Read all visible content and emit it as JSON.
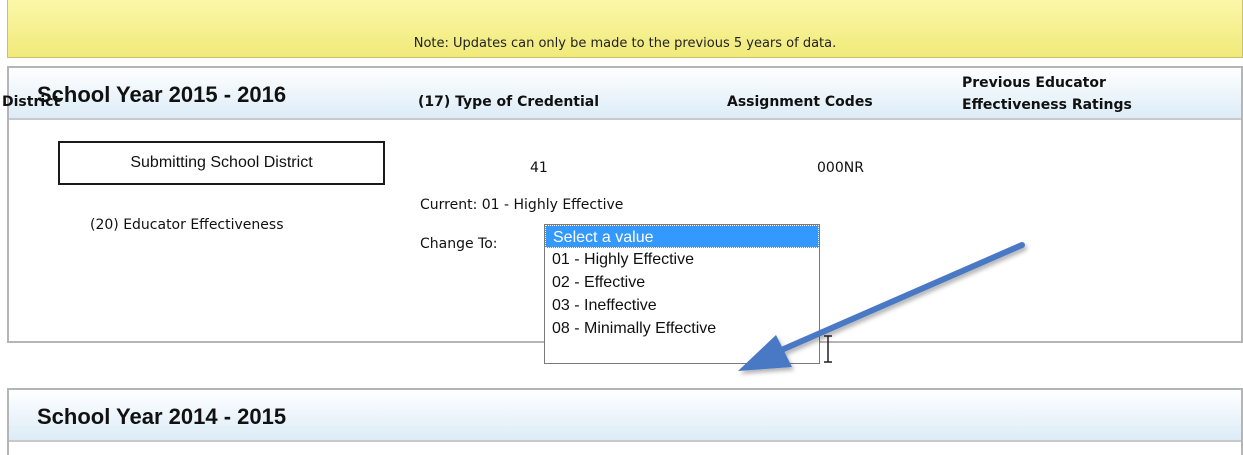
{
  "note": {
    "text": "Note: Updates can only be made to the previous 5 years of data."
  },
  "sections": [
    {
      "title": "School Year 2015 - 2016",
      "columns": {
        "district": "District",
        "credential": "(17) Type of Credential",
        "assignment": "Assignment Codes",
        "previous": "Previous Educator Effectiveness Ratings"
      },
      "district_value": "Submitting School District",
      "credential_value": "41",
      "assignment_value": "000NR",
      "effectiveness_label": "(20) Educator Effectiveness",
      "current_text": "Current: 01 - Highly Effective",
      "change_label": "Change To:",
      "dropdown": {
        "selected": "Select a value",
        "options": [
          "Select a value",
          "01 - Highly Effective",
          "02 - Effective",
          "03 - Ineffective",
          "08 - Minimally Effective"
        ]
      }
    },
    {
      "title": "School Year 2014 - 2015"
    }
  ],
  "colors": {
    "note_background": "#f4ee8c",
    "header_gradient_end": "#dcecf7",
    "selected_option": "#3399ff",
    "arrow": "#4a78c4"
  },
  "icons": [
    "arrow-annotation-icon",
    "text-cursor-icon"
  ]
}
